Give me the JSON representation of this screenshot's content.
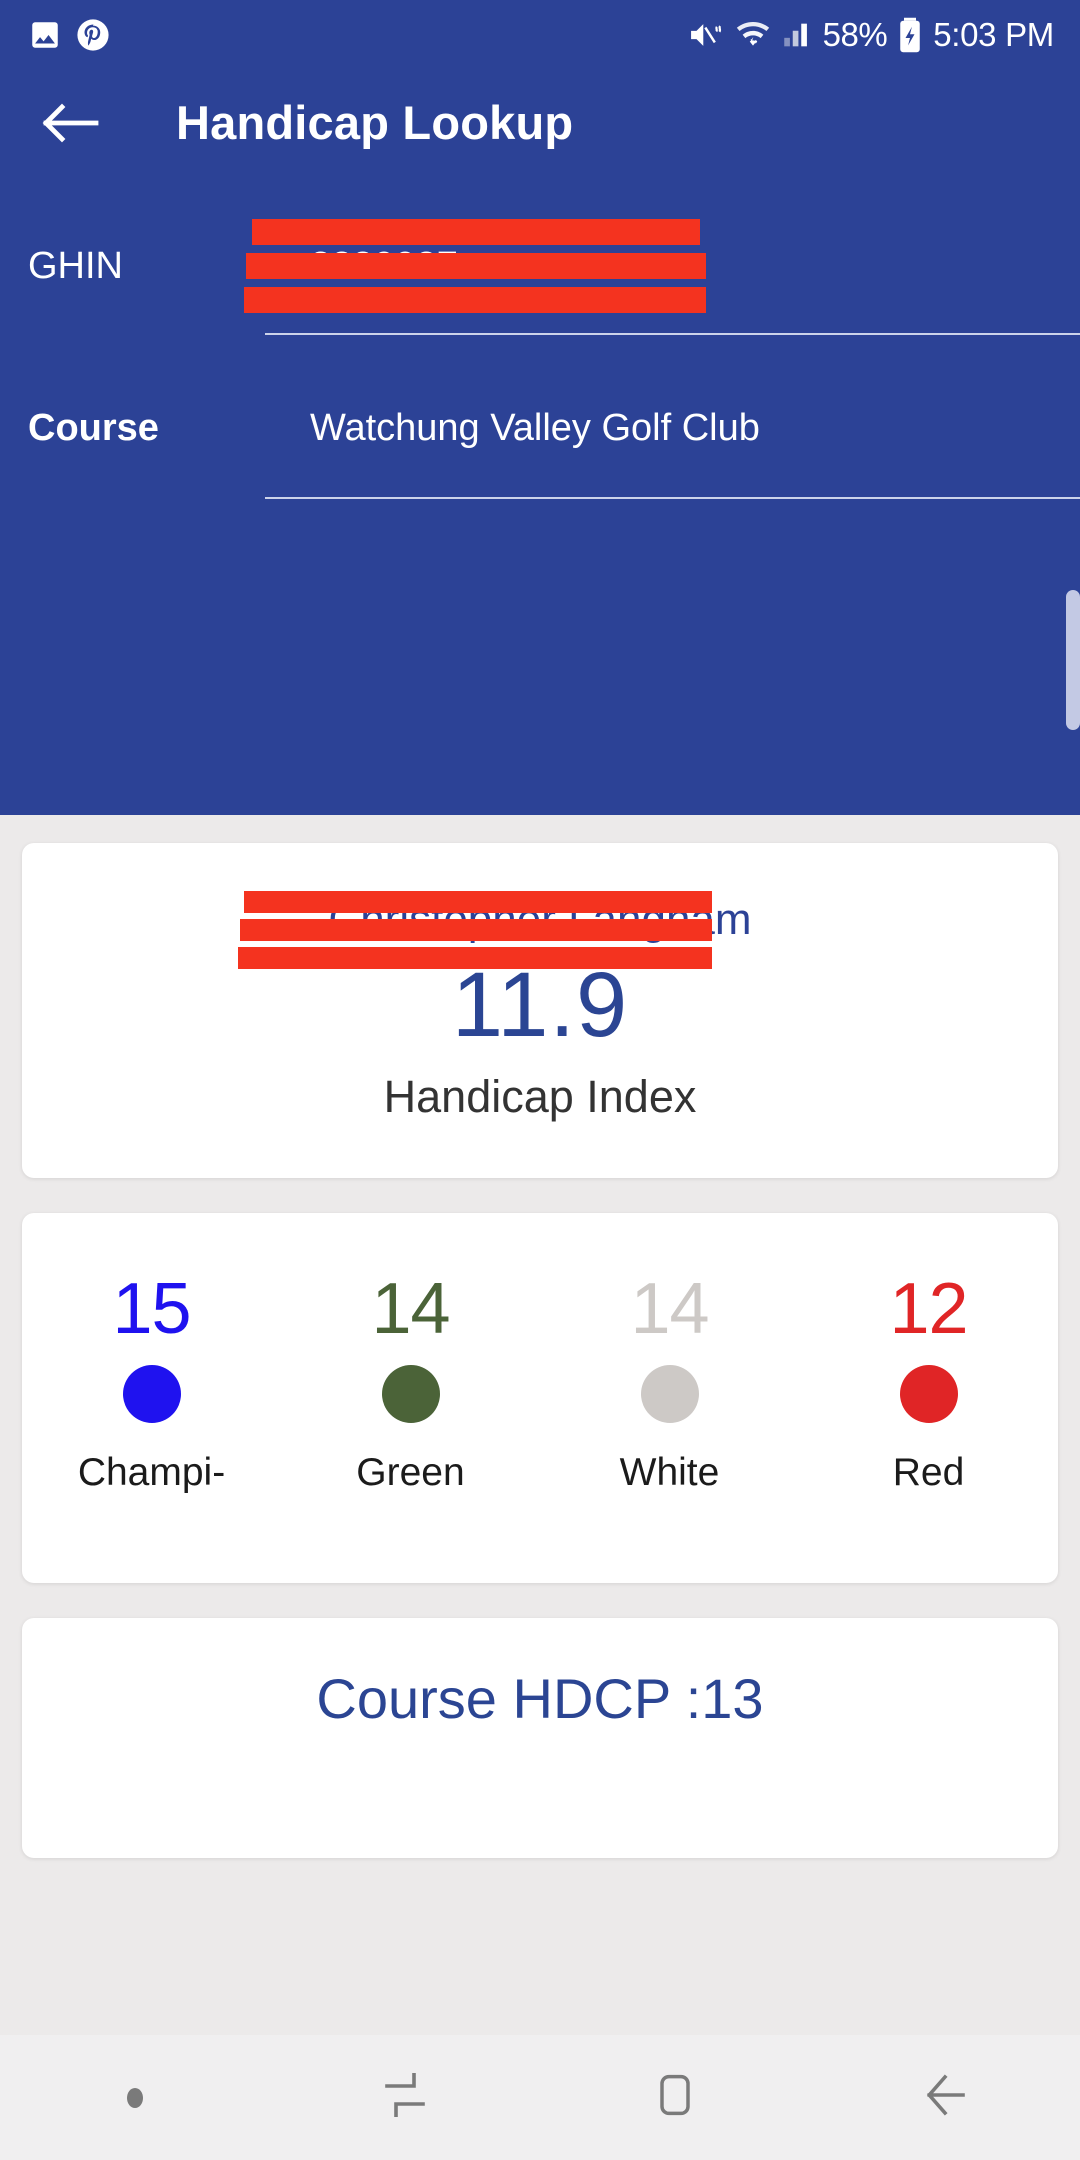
{
  "status_bar": {
    "icons": [
      "image-icon",
      "pinterest-icon",
      "mute-icon",
      "wifi-icon",
      "signal-icon",
      "battery-charging-icon"
    ],
    "battery_percent": "58%",
    "time": "5:03 PM"
  },
  "app_bar": {
    "back_icon": "back-arrow-icon",
    "title": "Handicap Lookup"
  },
  "form": {
    "ghin": {
      "label": "GHIN",
      "value": "2230027",
      "redacted": true
    },
    "course": {
      "label": "Course",
      "value": "Watchung Valley Golf Club"
    }
  },
  "index_card": {
    "player_name": "Christopher Langham",
    "player_name_redacted": true,
    "value": "11.9",
    "label": "Handicap Index"
  },
  "tees_card": {
    "tees": [
      {
        "number": "15",
        "name": "Champi-",
        "num_color": "#1f12ef",
        "dot_color": "#1f12ef"
      },
      {
        "number": "14",
        "name": "Green",
        "num_color": "#4b6338",
        "dot_color": "#4b6338"
      },
      {
        "number": "14",
        "name": "White",
        "num_color": "#cdc9c6",
        "dot_color": "#cdc9c6"
      },
      {
        "number": "12",
        "name": "Red",
        "num_color": "#e02526",
        "dot_color": "#e02526"
      }
    ]
  },
  "hdcp_card": {
    "text": "Course HDCP :13"
  },
  "nav_bar": {
    "items": [
      "dot-indicator",
      "recents-icon",
      "home-icon",
      "back-icon"
    ]
  },
  "colors": {
    "primary_blue": "#2c4296",
    "card_white": "#ffffff",
    "page_gray": "#eceaea",
    "redaction_red": "#f4331f"
  }
}
